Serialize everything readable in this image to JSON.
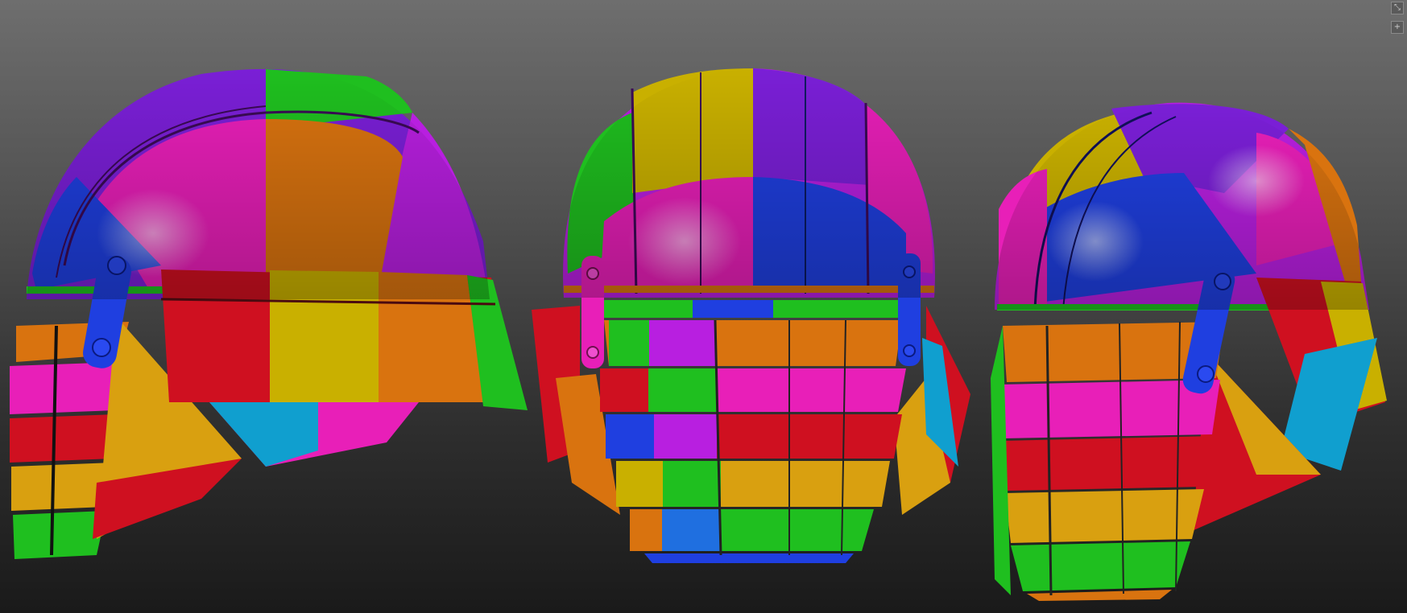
{
  "viewport": {
    "background_top": "#6e6e6e",
    "background_bottom": "#1a1a1a"
  },
  "scene": {
    "subject": "helmet",
    "views": [
      "side",
      "front",
      "three-quarter"
    ],
    "palette": {
      "purple": "#7a1fd6",
      "magenta": "#e81fb8",
      "orange": "#d9730f",
      "green": "#1fbf1f",
      "blue": "#1f3fe0",
      "red": "#cf1020",
      "yellow": "#c9b000",
      "cyan": "#109fcf",
      "gold": "#d9a010",
      "violet": "#b81fe0"
    }
  },
  "corner_tools": [
    {
      "icon": "resize-icon",
      "glyph": "⤡"
    },
    {
      "icon": "plus-icon",
      "glyph": "+"
    }
  ]
}
